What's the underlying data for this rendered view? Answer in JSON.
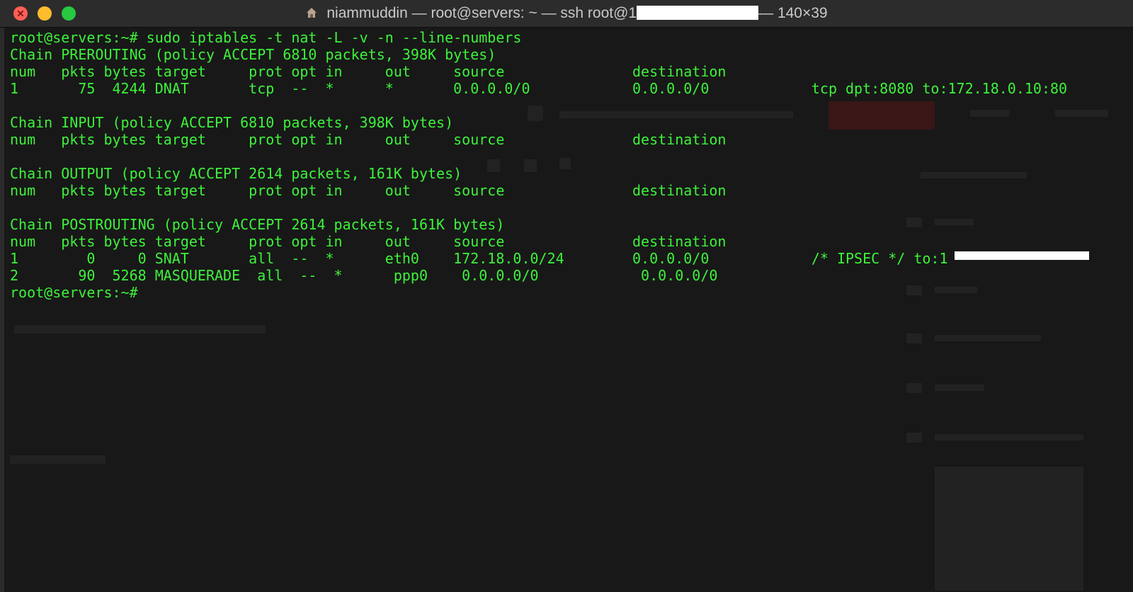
{
  "window": {
    "title_user": "niammuddin",
    "title_rest": "— root@servers: ~ — ssh root@1",
    "title_size": "— 140×39"
  },
  "terminal": {
    "lines": [
      "root@servers:~# sudo iptables -t nat -L -v -n --line-numbers",
      "Chain PREROUTING (policy ACCEPT 6810 packets, 398K bytes)",
      "num   pkts bytes target     prot opt in     out     source               destination",
      "1       75  4244 DNAT       tcp  --  *      *       0.0.0.0/0            0.0.0.0/0            tcp dpt:8080 to:172.18.0.10:80",
      "",
      "Chain INPUT (policy ACCEPT 6810 packets, 398K bytes)",
      "num   pkts bytes target     prot opt in     out     source               destination",
      "",
      "Chain OUTPUT (policy ACCEPT 2614 packets, 161K bytes)",
      "num   pkts bytes target     prot opt in     out     source               destination",
      "",
      "Chain POSTROUTING (policy ACCEPT 2614 packets, 161K bytes)",
      "num   pkts bytes target     prot opt in     out     source               destination",
      "1        0     0 SNAT       all  --  *      eth0    172.18.0.0/24        0.0.0.0/0            /* IPSEC */ to:1",
      "2       90  5268 MASQUERADE  all  --  *      ppp0    0.0.0.0/0            0.0.0.0/0",
      "root@servers:~#"
    ]
  }
}
